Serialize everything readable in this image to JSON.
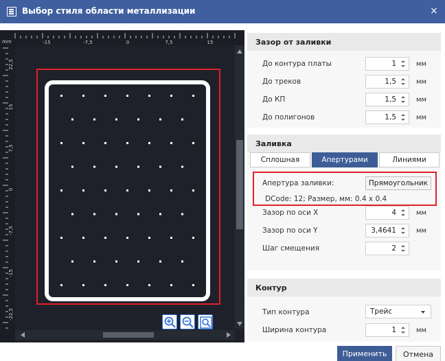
{
  "window": {
    "title": "Выбор стиля области металлизации",
    "close_glyph": "×",
    "icon": "dialog-icon"
  },
  "preview": {
    "unit": "mm",
    "x_ticks": [
      "-15",
      "-7,5",
      "0",
      "7,5",
      "15"
    ],
    "y_ticks": [
      "22,5",
      "15",
      "7,5",
      "0",
      "-7,5",
      "-15",
      "-22,5"
    ],
    "colors": {
      "background": "#1e2129",
      "outline": "#ffffff",
      "highlight": "#e0202a",
      "ruler": "#1b1d24"
    },
    "zoom_in_icon": "zoom-in-icon",
    "zoom_out_icon": "zoom-out-icon",
    "zoom_fit_icon": "zoom-fit-icon"
  },
  "clearance": {
    "title": "Зазор от заливки",
    "rows": [
      {
        "label": "До контура платы",
        "value": "1",
        "unit": "мм"
      },
      {
        "label": "До треков",
        "value": "1,5",
        "unit": "мм"
      },
      {
        "label": "До КП",
        "value": "1,5",
        "unit": "мм"
      },
      {
        "label": "До полигонов",
        "value": "1,5",
        "unit": "мм"
      }
    ]
  },
  "fill": {
    "title": "Заливка",
    "tabs": [
      {
        "label": "Сплошная",
        "active": false
      },
      {
        "label": "Апертурами",
        "active": true
      },
      {
        "label": "Линиями",
        "active": false
      }
    ],
    "aperture_label": "Апертура заливки:",
    "aperture_button": "Прямоугольник",
    "dcode_info": "DCode: 12; Размер, мм: 0.4 x 0.4",
    "gap_x": {
      "label": "Зазор по оси X",
      "value": "4",
      "unit": "мм"
    },
    "gap_y": {
      "label": "Зазор по оси Y",
      "value": "3,4641",
      "unit": "мм"
    },
    "offset_step": {
      "label": "Шаг смещения",
      "value": "2"
    }
  },
  "contour": {
    "title": "Контур",
    "type_label": "Тип контура",
    "type_value": "Трейс",
    "width_label": "Ширина контура",
    "width_value": "1",
    "width_unit": "мм"
  },
  "footer": {
    "apply": "Применить",
    "cancel": "Отмена"
  },
  "accent": "#3e5d96"
}
